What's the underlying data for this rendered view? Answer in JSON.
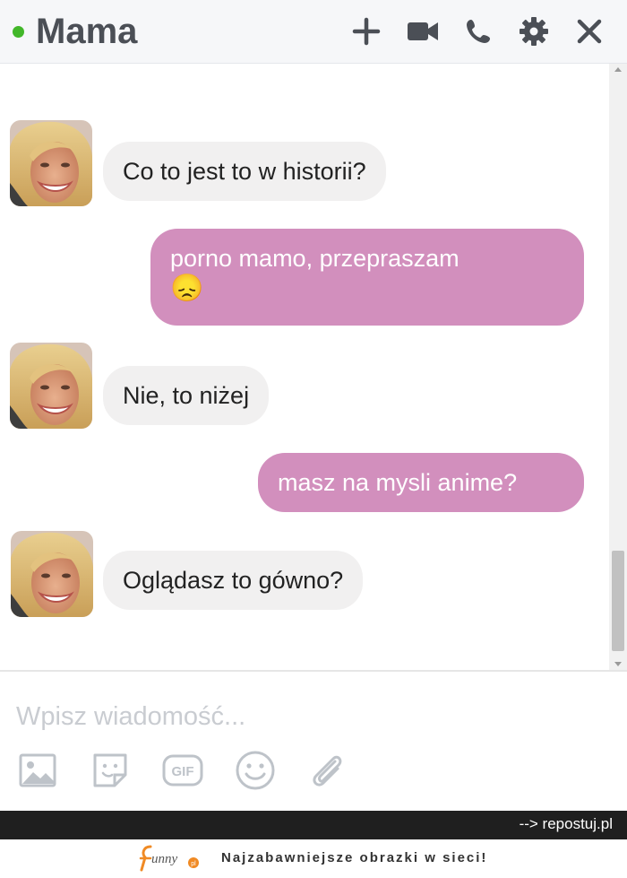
{
  "header": {
    "title": "Mama",
    "status": "online",
    "status_color": "#42b72a",
    "icons": [
      "plus-icon",
      "video-camera-icon",
      "phone-icon",
      "gear-icon",
      "close-icon"
    ]
  },
  "messages": [
    {
      "from": "Mama",
      "direction": "incoming",
      "text": "Co to jest to w historii?"
    },
    {
      "from": "me",
      "direction": "outgoing",
      "text": "porno mamo, przepraszam",
      "emoji": "😞"
    },
    {
      "from": "Mama",
      "direction": "incoming",
      "text": "Nie, to niżej"
    },
    {
      "from": "me",
      "direction": "outgoing",
      "text": "masz na mysli anime?"
    },
    {
      "from": "Mama",
      "direction": "incoming",
      "text": "Oglądasz to gówno?"
    }
  ],
  "composer": {
    "placeholder": "Wpisz wiadomość...",
    "tools": [
      "image-icon",
      "sticker-icon",
      "gif-icon",
      "emoji-icon",
      "attachment-icon"
    ],
    "gif_label": "GIF"
  },
  "footer": {
    "credit": "--> repostuj.pl",
    "logo_text": "funny",
    "tagline": "Najzabawniejsze obrazki w sieci!"
  },
  "colors": {
    "outgoing_bubble": "#d28fbd",
    "incoming_bubble": "#f1f0f0",
    "header_bg": "#f6f7f9",
    "icon_gray": "#4b4f56"
  }
}
